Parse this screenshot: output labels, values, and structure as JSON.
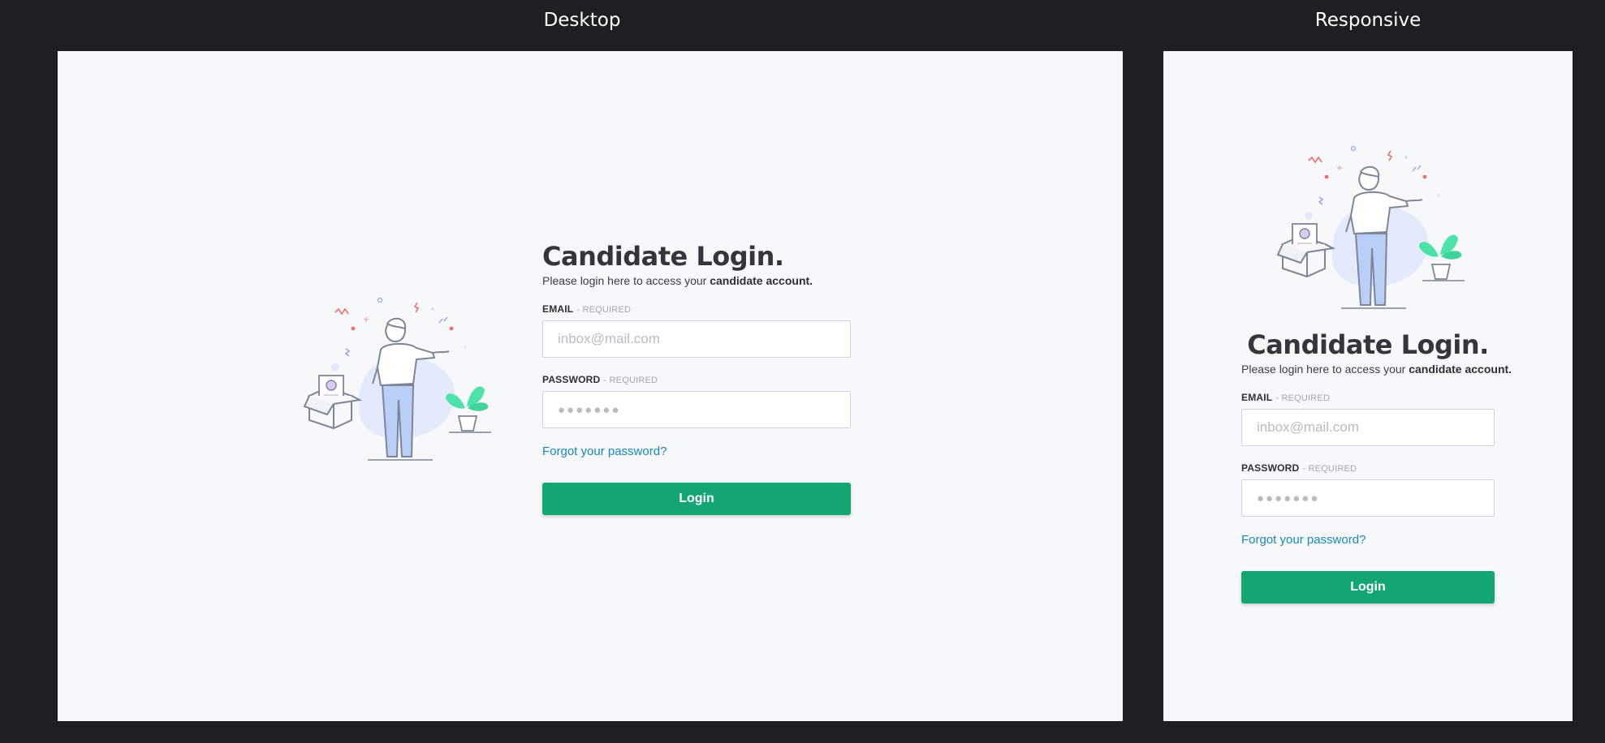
{
  "panels": {
    "desktop_label": "Desktop",
    "responsive_label": "Responsive"
  },
  "login": {
    "title": "Candidate Login.",
    "subtitle_prefix": "Please login here to access your ",
    "subtitle_bold": "candidate account.",
    "email_label": "EMAIL",
    "email_required": "- REQUIRED",
    "email_placeholder": "inbox@mail.com",
    "password_label": "PASSWORD",
    "password_required": "- REQUIRED",
    "password_placeholder": "●●●●●●●",
    "forgot_link": "Forgot your password?",
    "login_button": "Login"
  },
  "colors": {
    "background": "#1e1f21",
    "panel": "#f6f8fa",
    "primary": "#13a673",
    "link": "#1a86c0",
    "confetti_red": "#ef6f6c",
    "confetti_blue": "#8aa7ff",
    "plant_green": "#4de3a8",
    "jeans_blue": "#b9cff7"
  }
}
